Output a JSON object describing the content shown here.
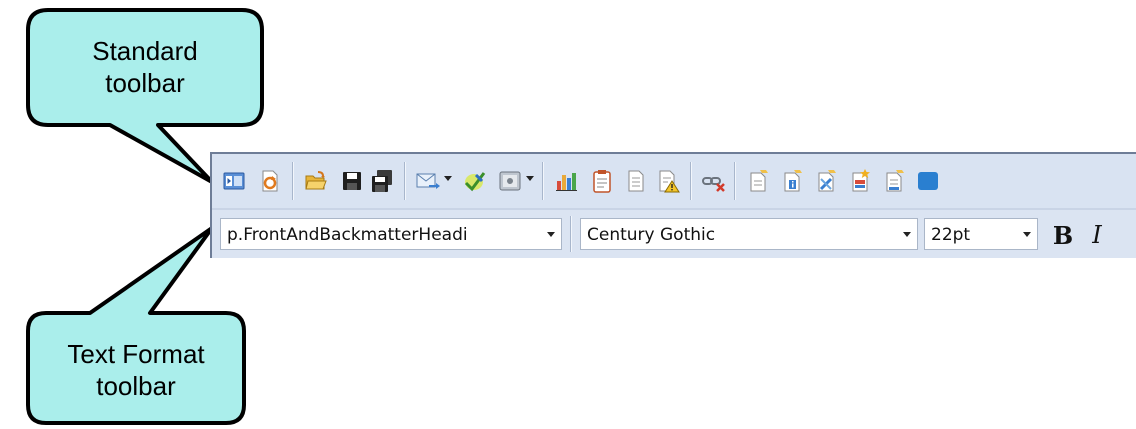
{
  "callouts": {
    "standard": {
      "line1": "Standard",
      "line2": "toolbar"
    },
    "text_format": {
      "line1": "Text Format",
      "line2": "toolbar"
    },
    "fill_color": "#aaeeeb",
    "border_color": "#000000"
  },
  "standard_toolbar": {
    "icons": [
      "preview-icon",
      "document-refresh-icon",
      "open-folder-icon",
      "save-icon",
      "save-all-icon",
      "send-email-icon",
      "spell-check-icon",
      "view-icon",
      "chart-icon",
      "clipboard-icon",
      "page-icon",
      "warning-page-icon",
      "unlink-icon",
      "edit-page-icon",
      "info-page-icon",
      "link-page-icon",
      "star-page-icon",
      "new-page-icon"
    ]
  },
  "text_format_toolbar": {
    "style_value": "p.FrontAndBackmatterHeadi",
    "font_value": "Century Gothic",
    "size_value": "22pt",
    "bold_label": "B",
    "italic_label": "I"
  },
  "colors": {
    "toolbar_bg": "#d9e3f2",
    "toolbar_border": "#6e7d97"
  }
}
